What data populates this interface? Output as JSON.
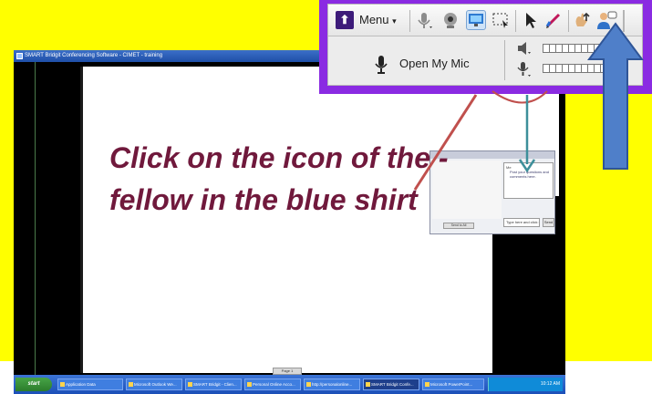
{
  "slide": {
    "callout_line1": "Click on the icon of the -",
    "callout_line2": "fellow in the blue shirt",
    "callout_color": "#70193c",
    "background_color": "#ffff00",
    "arrow_color": "#4f7fc9"
  },
  "screenshot": {
    "title": "SMART Bridgit Conferencing Software - CIMET - training",
    "scroll_tab": "Page 1",
    "taskbar": {
      "start_label": "start",
      "tasks": [
        "Application Data",
        "Microsoft Outlook We...",
        "SMART Bridgit - Clien...",
        "Personal Online Acco...",
        "http://personalonline...",
        "SMART Bridgit Confe...",
        "Microsoft PowerPoint..."
      ],
      "clock": "10:12 AM"
    },
    "chat": {
      "message_from": "Me",
      "message_body": "Post your questions and comments here.",
      "input_placeholder": "Type here and click send",
      "send_label": "Send",
      "participants_label": "Send to All"
    }
  },
  "toolbar": {
    "menu_label": "Menu",
    "open_mic_label": "Open My Mic",
    "icons": [
      "smart-logo-icon",
      "microphone-dropdown-icon",
      "webcam-icon",
      "share-desktop-icon",
      "select-region-icon",
      "pointer-icon",
      "pen-icon",
      "raise-hand-icon",
      "chat-person-icon"
    ]
  }
}
